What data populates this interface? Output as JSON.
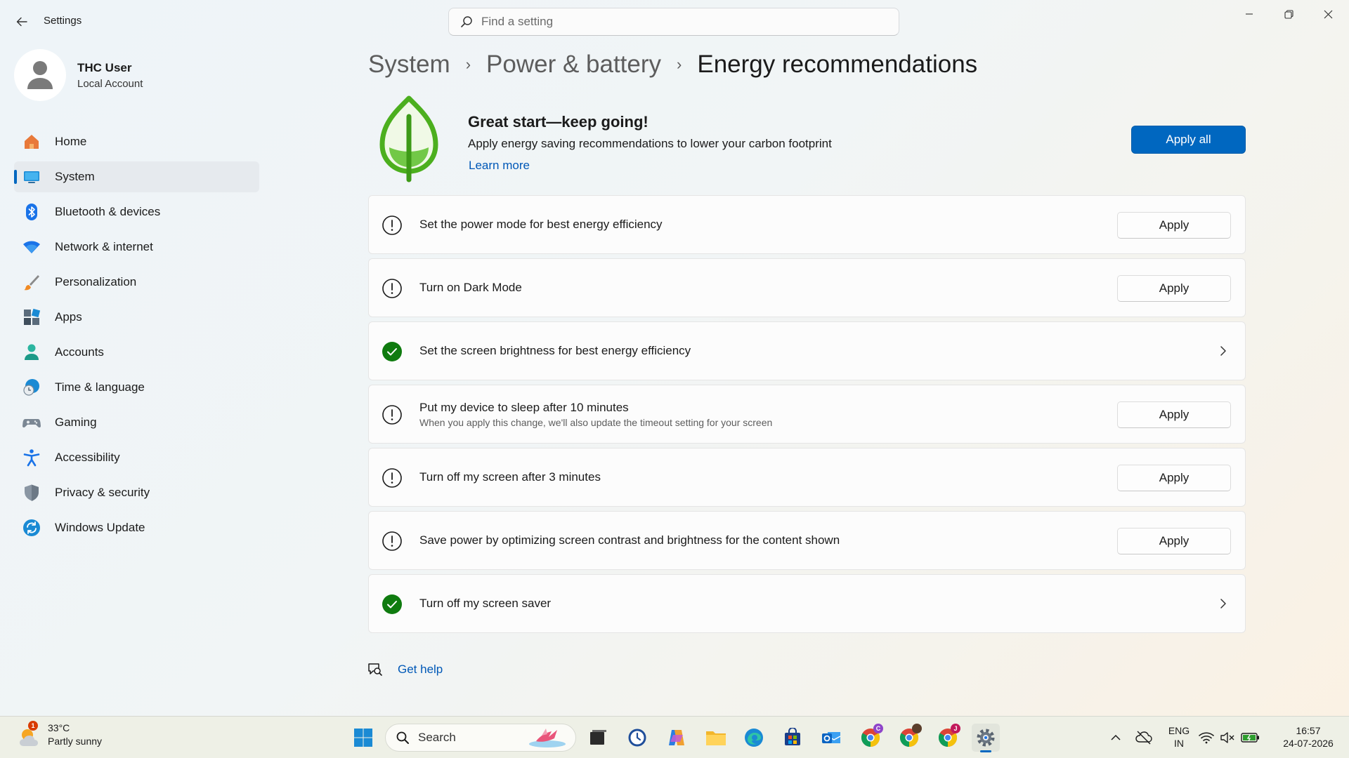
{
  "window": {
    "title": "Settings"
  },
  "search": {
    "placeholder": "Find a setting"
  },
  "profile": {
    "name": "THC User",
    "account_type": "Local Account"
  },
  "sidebar": {
    "items": [
      {
        "label": "Home",
        "icon": "home-icon"
      },
      {
        "label": "System",
        "icon": "system-icon",
        "active": true
      },
      {
        "label": "Bluetooth & devices",
        "icon": "bluetooth-icon"
      },
      {
        "label": "Network & internet",
        "icon": "wifi-icon"
      },
      {
        "label": "Personalization",
        "icon": "brush-icon"
      },
      {
        "label": "Apps",
        "icon": "apps-icon"
      },
      {
        "label": "Accounts",
        "icon": "person-icon"
      },
      {
        "label": "Time & language",
        "icon": "globe-clock-icon"
      },
      {
        "label": "Gaming",
        "icon": "gamepad-icon"
      },
      {
        "label": "Accessibility",
        "icon": "accessibility-icon"
      },
      {
        "label": "Privacy & security",
        "icon": "shield-icon"
      },
      {
        "label": "Windows Update",
        "icon": "update-icon"
      }
    ]
  },
  "breadcrumb": {
    "items": [
      "System",
      "Power & battery"
    ],
    "current": "Energy recommendations",
    "separator": "›"
  },
  "hero": {
    "title": "Great start—keep going!",
    "description": "Apply energy saving recommendations to lower your carbon footprint",
    "learn_more": "Learn more",
    "apply_all": "Apply all"
  },
  "recommendations": [
    {
      "title": "Set the power mode for best energy efficiency",
      "status": "pending",
      "action": "Apply"
    },
    {
      "title": "Turn on Dark Mode",
      "status": "pending",
      "action": "Apply"
    },
    {
      "title": "Set the screen brightness for best energy efficiency",
      "status": "done"
    },
    {
      "title": "Put my device to sleep after 10 minutes",
      "subtitle": "When you apply this change, we'll also update the timeout setting for your screen",
      "status": "pending",
      "action": "Apply"
    },
    {
      "title": "Turn off my screen after 3 minutes",
      "status": "pending",
      "action": "Apply"
    },
    {
      "title": "Save power by optimizing screen contrast and brightness for the content shown",
      "status": "pending",
      "action": "Apply"
    },
    {
      "title": "Turn off my screen saver",
      "status": "done"
    }
  ],
  "help": {
    "label": "Get help"
  },
  "taskbar": {
    "weather": {
      "temp": "33°C",
      "condition": "Partly sunny",
      "badge": "1"
    },
    "search_label": "Search",
    "language": {
      "line1": "ENG",
      "line2": "IN"
    },
    "clock": {
      "time": "16:57",
      "date": "24-07-2026"
    },
    "badges": {
      "chrome1": "C",
      "chrome3": "J"
    }
  },
  "colors": {
    "accent": "#0067c0",
    "success": "#0f7b0f",
    "leaf": "#4caf1e"
  }
}
